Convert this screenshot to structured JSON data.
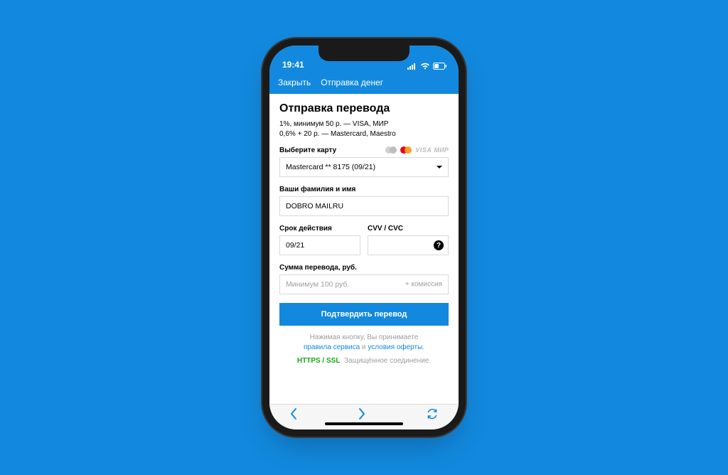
{
  "statusbar": {
    "time": "19:41"
  },
  "header": {
    "close": "Закрыть",
    "title": "Отправка денег"
  },
  "page": {
    "title": "Отправка перевода",
    "fee_line1": "1%, минимум 50 р. — VISA, МИР",
    "fee_line2": "0,6% + 20 р. — Mastercard, Maestro"
  },
  "card": {
    "label": "Выберите карту",
    "selected": "Mastercard ** 8175 (09/21)",
    "logos": {
      "visa": "VISA",
      "mir": "МИР"
    }
  },
  "name": {
    "label": "Ваши фамилия и имя",
    "value": "DOBRO MAILRU"
  },
  "expiry": {
    "label": "Срок действия",
    "value": "09/21"
  },
  "cvv": {
    "label": "CVV / CVC",
    "value": "",
    "help": "?"
  },
  "amount": {
    "label": "Сумма перевода, руб.",
    "placeholder": "Минимум 100 руб.",
    "suffix": "+ комиссия"
  },
  "submit": "Подтвердить перевод",
  "agree": {
    "line1": "Нажимая кнопку, Вы принимаете",
    "rules": "правила сервиса",
    "and": " и ",
    "offer": "условия оферты",
    "dot": "."
  },
  "ssl": {
    "badge": "HTTPS / SSL",
    "text": "Защищённое соединение."
  }
}
